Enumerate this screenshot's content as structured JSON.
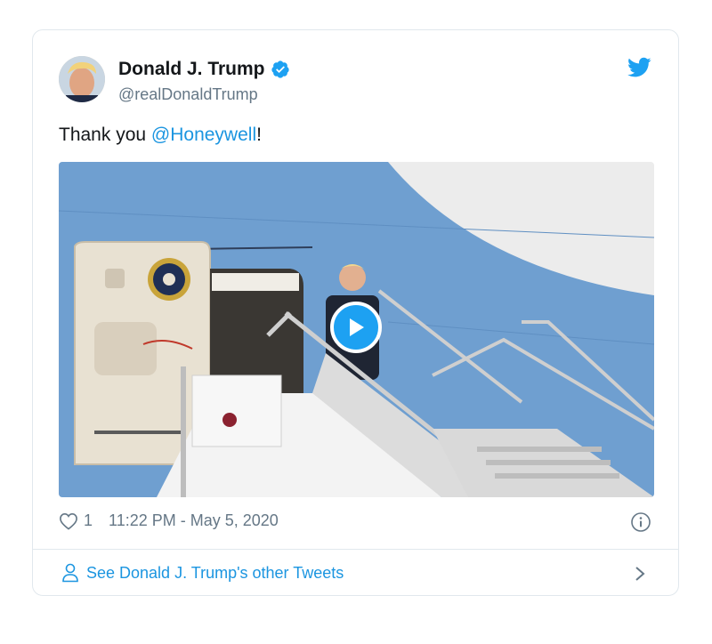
{
  "tweet": {
    "author_name": "Donald J. Trump",
    "handle": "@realDonaldTrump",
    "text_prefix": "Thank you ",
    "mention": "@Honeywell",
    "text_suffix": "!",
    "like_count": "1",
    "timestamp": "11:22 PM - May 5, 2020",
    "has_video": true
  },
  "footer": {
    "link_label": "See Donald J. Trump's other Tweets"
  },
  "icons": {
    "verified": "verified-badge-icon",
    "brand": "twitter-bird-icon",
    "like": "heart-icon",
    "info": "info-icon",
    "person": "person-icon",
    "chevron": "chevron-right-icon",
    "play": "play-icon"
  },
  "colors": {
    "brand_blue": "#1da1f2",
    "link_blue": "#1b95e0",
    "secondary_text": "#657786",
    "border": "#e1e8ed"
  }
}
